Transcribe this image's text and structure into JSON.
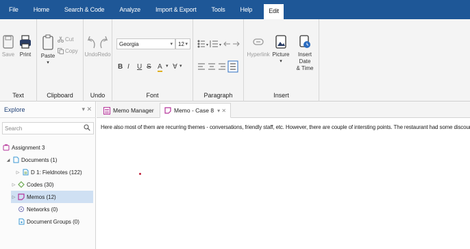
{
  "menu": {
    "items": [
      "File",
      "Home",
      "Search & Code",
      "Analyze",
      "Import & Export",
      "Tools",
      "Help",
      "Edit"
    ],
    "active": "Edit"
  },
  "ribbon": {
    "text_group": {
      "label": "Text",
      "save": "Save",
      "print": "Print"
    },
    "clipboard_group": {
      "label": "Clipboard",
      "paste": "Paste",
      "cut": "Cut",
      "copy": "Copy"
    },
    "undo_group": {
      "label": "Undo",
      "undo": "Undo",
      "redo": "Redo"
    },
    "font_group": {
      "label": "Font",
      "font_name": "Georgia",
      "font_size": "12",
      "bold": "B",
      "italic": "I",
      "underline": "U",
      "strike": "S",
      "font_color": "A",
      "highlight": "∀"
    },
    "paragraph_group": {
      "label": "Paragraph"
    },
    "insert_group": {
      "label": "Insert",
      "hyperlink": "Hyperlink",
      "picture": "Picture",
      "insert_date_line1": "Insert Date",
      "insert_date_line2": "& Time"
    }
  },
  "explore": {
    "title": "Explore",
    "search_placeholder": "Search",
    "tree": [
      {
        "label": "Assignment 3",
        "icon": "project-icon"
      },
      {
        "label": "Documents (1)",
        "icon": "folder-icon"
      },
      {
        "label": "D 1: Fieldnotes (122)",
        "icon": "document-icon"
      },
      {
        "label": "Codes (30)",
        "icon": "code-icon"
      },
      {
        "label": "Memos (12)",
        "icon": "memo-icon"
      },
      {
        "label": "Networks (0)",
        "icon": "network-icon"
      },
      {
        "label": "Document Groups (0)",
        "icon": "group-icon"
      }
    ]
  },
  "tabs": [
    {
      "label": "Memo Manager",
      "icon": "memo-manager-icon"
    },
    {
      "label": "Memo - Case 8",
      "icon": "memo-icon"
    }
  ],
  "document": {
    "text": "Here also most of them are recurring themes - conversations, friendly staff, etc. However, there are couple of intersting points. The restaurant had some discounts to attr"
  },
  "colors": {
    "menubar": "#1e5797",
    "memo": "#b5339a",
    "accent_blue": "#2b6cc0",
    "selected_row": "#cfe0f3"
  }
}
